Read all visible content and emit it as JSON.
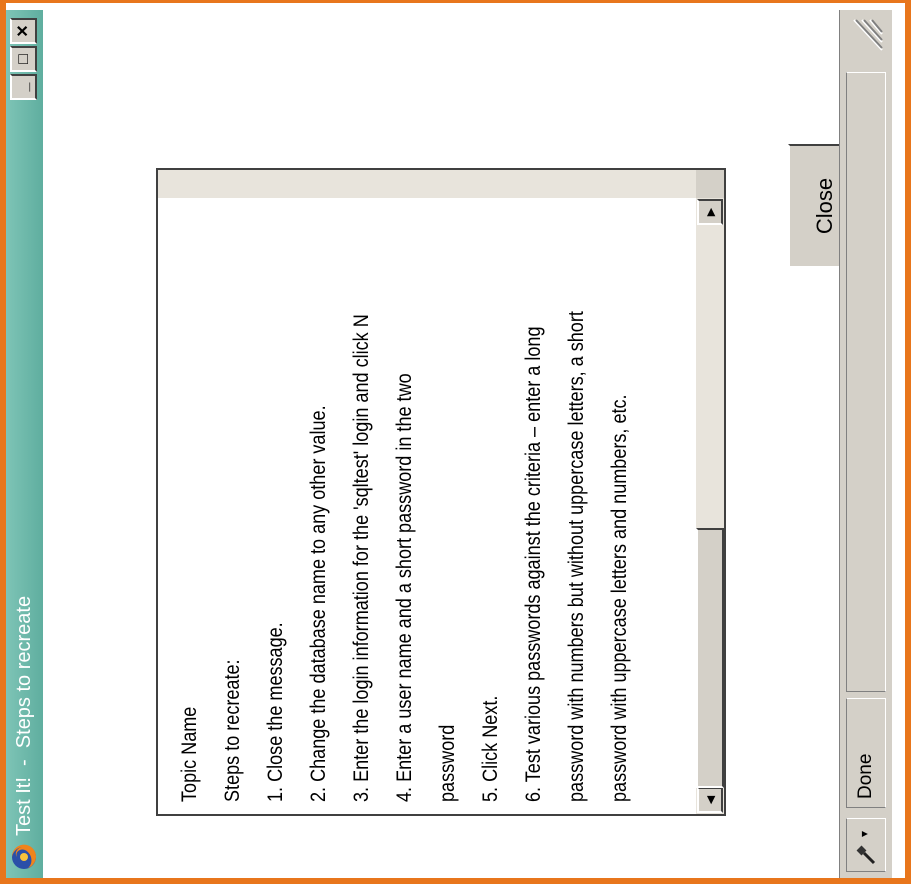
{
  "window": {
    "title": "Test It!  -  Steps to recreate",
    "min_label": "_",
    "max_label": "□",
    "close_label": "×"
  },
  "content": {
    "lines": [
      "Topic Name",
      "Steps to recreate:",
      "1. Close the message.",
      "2. Change the database name to any other value.",
      "3. Enter the login information for the 'sqltest' login and click N",
      "4. Enter a user name and a short password in the two",
      "password",
      "5. Click Next.",
      "6. Test various passwords against the criteria – enter a long",
      "password with numbers but without uppercase letters, a short",
      "password with uppercase letters and numbers, etc."
    ],
    "scroll_left_arrow": "◀",
    "scroll_right_arrow": "▶",
    "close_button": "Close"
  },
  "statusbar": {
    "status": "Done",
    "icon": "eyedropper-icon",
    "dropdown_arrow": "▾"
  },
  "colors": {
    "frame": "#e8761c",
    "titlebar": "#6cb8a8",
    "chrome": "#d4d0c8"
  }
}
